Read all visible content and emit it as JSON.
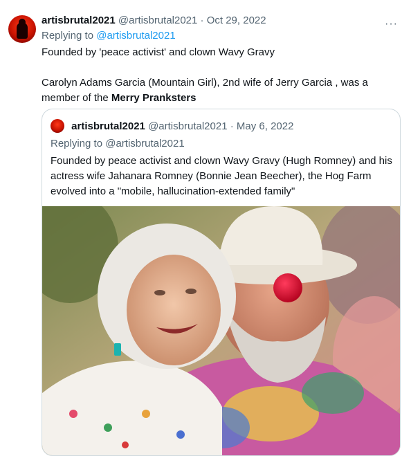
{
  "tweet": {
    "display_name": "artisbrutal2021",
    "handle": "@artisbrutal2021",
    "date": "· Oct 29, 2022",
    "replying_prefix": "Replying to",
    "replying_to": "@artisbrutal2021",
    "line1": "Founded by 'peace activist' and clown Wavy Gravy",
    "line2_start": "Carolyn Adams Garcia (Mountain Girl), 2nd wife of Jerry Garcia , was a member of the",
    "line2_bold": "Merry Pranksters",
    "more_icon": "more-dots-icon"
  },
  "quoted": {
    "display_name": "artisbrutal2021",
    "handle": "@artisbrutal2021",
    "date": "· May 6, 2022",
    "replying": "Replying to @artisbrutal2021",
    "text": "Founded by peace activist and clown Wavy Gravy (Hugh Romney) and his actress wife Jahanara Romney (Bonnie Jean Beecher), the Hog Farm evolved into a \"mobile, hallucination-extended family\""
  }
}
